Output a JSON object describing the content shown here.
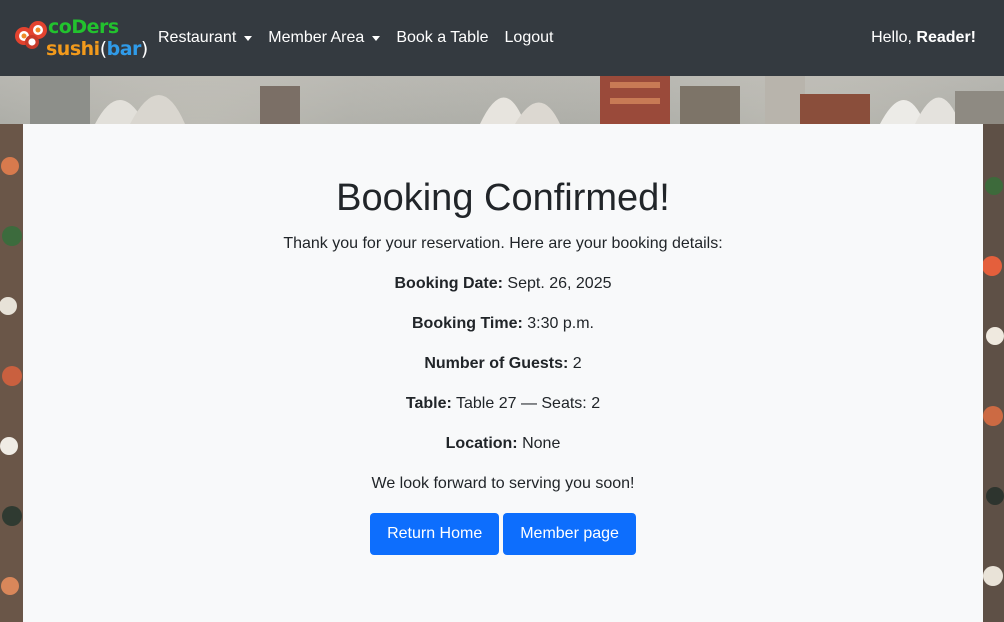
{
  "brand": {
    "line1": "coDers",
    "line2_word1": "sushi",
    "line2_paren_open": "(",
    "line2_word2": "bar",
    "line2_paren_close": ")",
    "icon": "sushi-rolls-icon"
  },
  "nav": {
    "items": [
      {
        "label": "Restaurant",
        "dropdown": true
      },
      {
        "label": "Member Area",
        "dropdown": true
      },
      {
        "label": "Book a Table",
        "dropdown": false
      },
      {
        "label": "Logout",
        "dropdown": false
      }
    ],
    "greeting": "Hello,",
    "username": "Reader!"
  },
  "confirmation": {
    "title": "Booking Confirmed!",
    "intro": "Thank you for your reservation. Here are your booking details:",
    "details": [
      {
        "label": "Booking Date:",
        "value": "Sept. 26, 2025"
      },
      {
        "label": "Booking Time:",
        "value": "3:30 p.m."
      },
      {
        "label": "Number of Guests:",
        "value": "2"
      },
      {
        "label": "Table:",
        "value": "Table 27 — Seats: 2"
      },
      {
        "label": "Location:",
        "value": "None"
      }
    ],
    "closing": "We look forward to serving you soon!",
    "buttons": {
      "home": "Return Home",
      "member": "Member page"
    }
  },
  "colors": {
    "navbar": "#343a40",
    "primary": "#0d6efd",
    "card": "#f8f9fa",
    "brand_green": "#22c22e",
    "brand_orange": "#f29a1c",
    "brand_blue": "#2f9be9"
  }
}
